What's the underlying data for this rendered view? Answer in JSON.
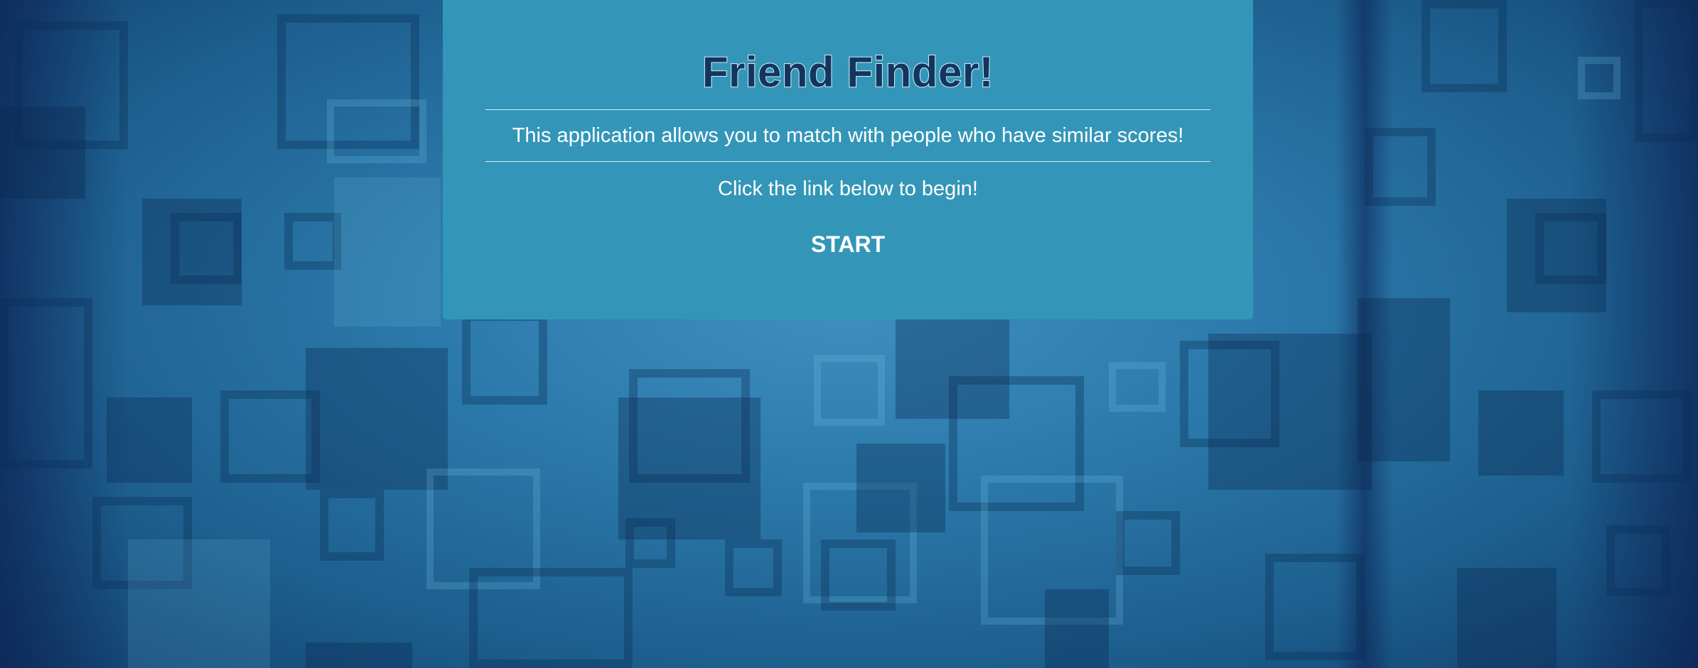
{
  "hero": {
    "title": "Friend Finder!",
    "description": "This application allows you to match with people who have similar scores!",
    "instruction": "Click the link below to begin!",
    "start_label": "START"
  },
  "colors": {
    "card_background": "#3396b8",
    "title_color": "#12365f",
    "text_color": "#ffffff",
    "page_background": "#1f6a9a"
  }
}
